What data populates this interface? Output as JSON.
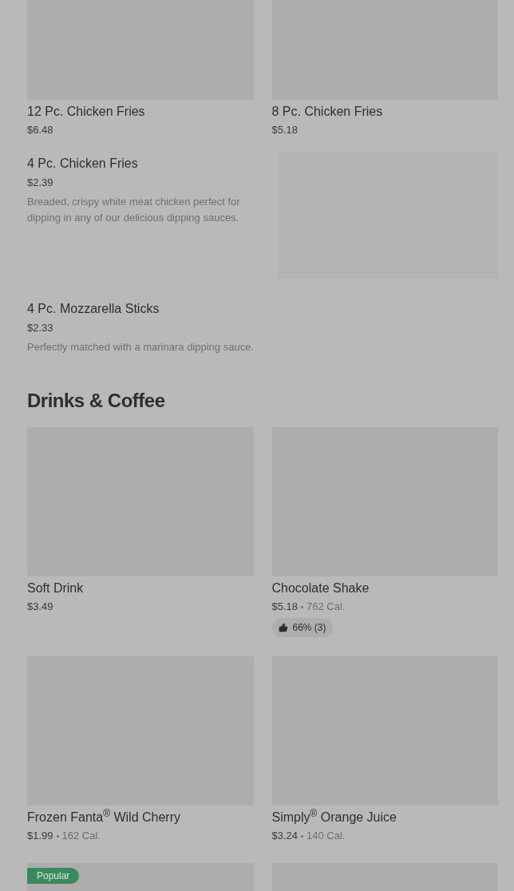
{
  "sections": [
    {
      "items": [
        {
          "kind": "card",
          "name": "12 Pc. Chicken Fries",
          "price": "$6.48"
        },
        {
          "kind": "card",
          "name": "8 Pc. Chicken Fries",
          "price": "$5.18"
        },
        {
          "kind": "row",
          "name": "4 Pc. Chicken Fries",
          "price": "$2.39",
          "description": "Breaded, crispy white meat chicken perfect for dipping in any of our delicious dipping sauces.",
          "image": true
        },
        {
          "kind": "row",
          "name": "4 Pc. Mozzarella Sticks",
          "price": "$2.33",
          "description": "Perfectly matched with a marinara dipping sauce.",
          "image": false
        }
      ]
    },
    {
      "title": "Drinks & Coffee",
      "items": [
        {
          "kind": "card",
          "name": "Soft Drink",
          "price": "$3.49"
        },
        {
          "kind": "card",
          "name": "Chocolate Shake",
          "price": "$5.18",
          "calories": "762 Cal.",
          "rating": "66% (3)"
        },
        {
          "kind": "card",
          "name": "Frozen Fanta$^{®}$ Wild Cherry",
          "price": "$1.99",
          "calories": "162 Cal."
        },
        {
          "kind": "card",
          "name": "Simply$^{®}$ Orange Juice",
          "price": "$3.24",
          "calories": "140 Cal."
        },
        {
          "kind": "card",
          "badge": "Popular"
        },
        {
          "kind": "card"
        }
      ]
    }
  ]
}
